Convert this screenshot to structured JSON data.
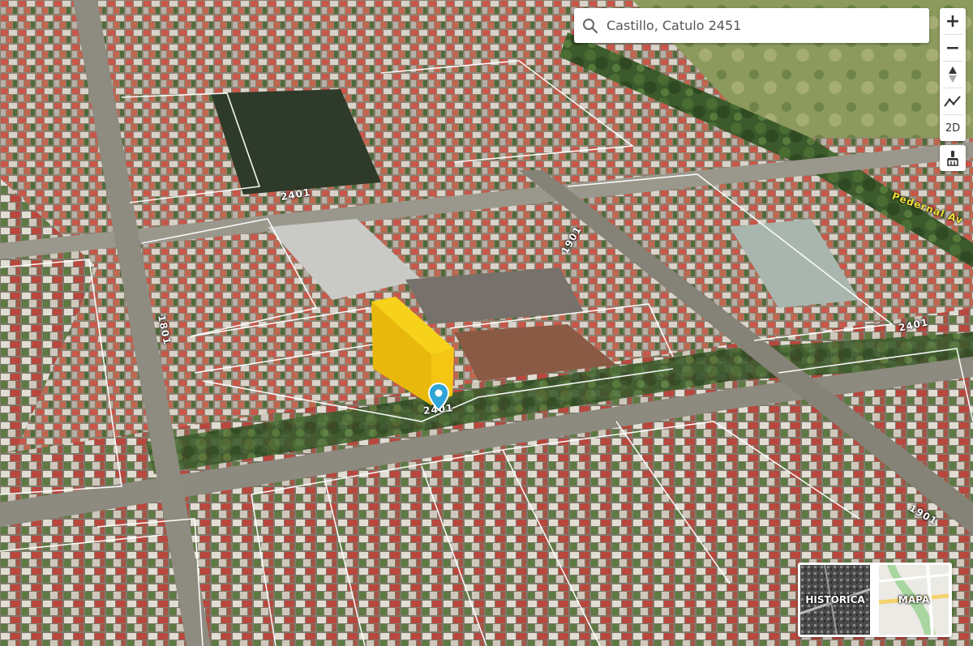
{
  "search": {
    "value": "Castillo, Catulo 2451",
    "icon": "search-icon"
  },
  "controls": {
    "zoom_in": "+",
    "zoom_out": "−",
    "mode_2d": "2D"
  },
  "street_labels": [
    "2401",
    "1901",
    "1801",
    "2401",
    "2401",
    "1901",
    "Pedernal Av"
  ],
  "basemaps": {
    "historic": "HISTÓRICA",
    "map": "MAPA"
  },
  "colors": {
    "building": "#f2c40c",
    "pin": "#2fa4d6"
  }
}
